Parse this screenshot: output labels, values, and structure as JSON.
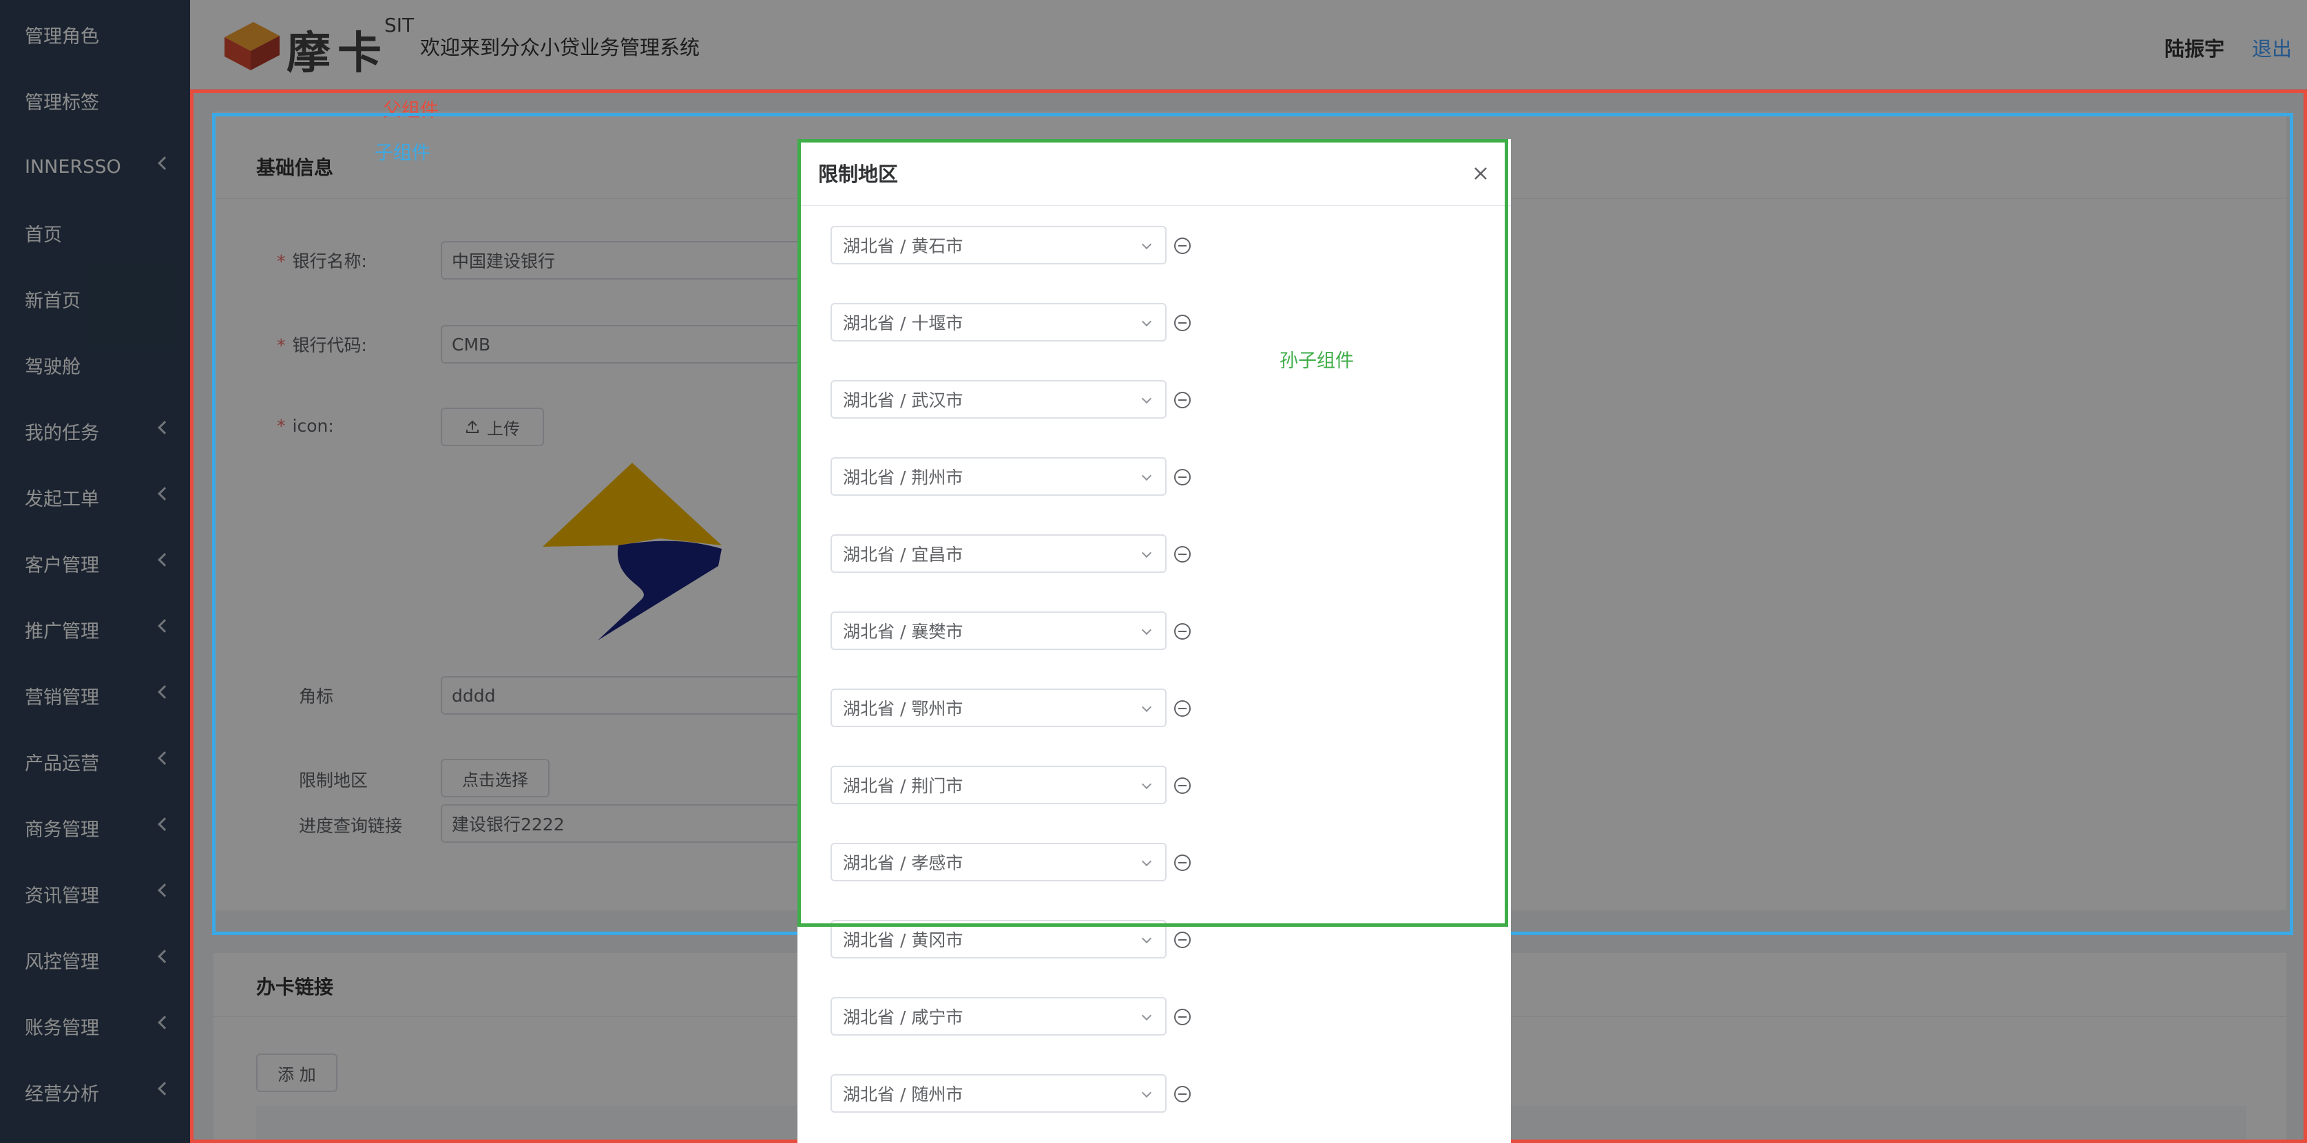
{
  "sidebar": {
    "items": [
      {
        "label": "管理角色",
        "expandable": false
      },
      {
        "label": "管理标签",
        "expandable": false
      },
      {
        "label": "INNERSSO",
        "expandable": true
      },
      {
        "label": "首页",
        "expandable": false
      },
      {
        "label": "新首页",
        "expandable": false
      },
      {
        "label": "驾驶舱",
        "expandable": false
      },
      {
        "label": "我的任务",
        "expandable": true
      },
      {
        "label": "发起工单",
        "expandable": true
      },
      {
        "label": "客户管理",
        "expandable": true
      },
      {
        "label": "推广管理",
        "expandable": true
      },
      {
        "label": "营销管理",
        "expandable": true
      },
      {
        "label": "产品运营",
        "expandable": true
      },
      {
        "label": "商务管理",
        "expandable": true
      },
      {
        "label": "资讯管理",
        "expandable": true
      },
      {
        "label": "风控管理",
        "expandable": true
      },
      {
        "label": "账务管理",
        "expandable": true
      },
      {
        "label": "经营分析",
        "expandable": true
      }
    ]
  },
  "header": {
    "brand": "摩卡",
    "env": "SIT",
    "welcome": "欢迎来到分众小贷业务管理系统",
    "user": "陆振宇",
    "logout": "退出"
  },
  "basic_info": {
    "title": "基础信息",
    "bank_name_label": "银行名称:",
    "bank_name_value": "中国建设银行",
    "bank_code_label": "银行代码:",
    "bank_code_value": "CMB",
    "icon_label": "icon:",
    "upload_label": "上传",
    "corner_label": "角标",
    "corner_value": "dddd",
    "region_label": "限制地区",
    "region_button": "点击选择",
    "progress_label": "进度查询链接",
    "progress_value": "建设银行2222"
  },
  "card_link": {
    "title": "办卡链接",
    "add_button": "添 加"
  },
  "annotations": {
    "parent": "父组件",
    "child": "子组件",
    "grandchild": "孙子组件"
  },
  "dialog": {
    "title": "限制地区",
    "regions": [
      "湖北省 / 黄石市",
      "湖北省 / 十堰市",
      "湖北省 / 武汉市",
      "湖北省 / 荆州市",
      "湖北省 / 宜昌市",
      "湖北省 / 襄樊市",
      "湖北省 / 鄂州市",
      "湖北省 / 荆门市",
      "湖北省 / 孝感市",
      "湖北省 / 黄冈市",
      "湖北省 / 咸宁市",
      "湖北省 / 随州市"
    ]
  },
  "colors": {
    "sidebar_bg": "#304156",
    "parent_outline": "#e84c3d",
    "child_outline": "#3ba9e6",
    "grandchild_outline": "#3fae49",
    "link": "#409eff"
  }
}
